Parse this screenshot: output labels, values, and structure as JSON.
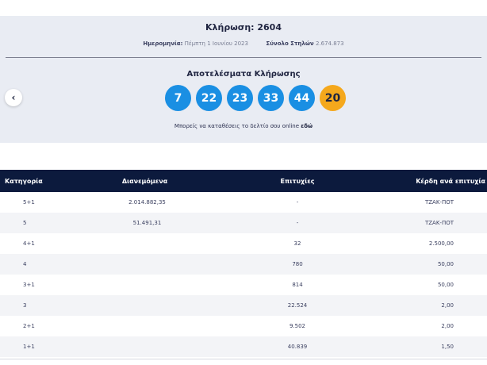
{
  "draw": {
    "title": "Κλήρωση: 2604",
    "date_label": "Ημερομηνία:",
    "date_value": "Πέμπτη 1 Ιουνίου 2023",
    "columns_label": "Σύνολο Στηλών",
    "columns_value": "2.674.873"
  },
  "results": {
    "title": "Αποτελέσματα Κλήρωσης",
    "numbers": [
      "7",
      "22",
      "23",
      "33",
      "44"
    ],
    "bonus": "20",
    "bet_text": "Μπορείς να καταθέσεις το δελτίο σου online",
    "bet_link": "εδώ",
    "prev_icon": "‹"
  },
  "colors": {
    "ball_main": "#1a8fe3",
    "ball_bonus": "#f5a81c",
    "header_bg": "#0c1a3d",
    "card_bg": "#e9ecf3"
  },
  "table": {
    "headers": [
      "Κατηγορία",
      "Διανεμόμενα",
      "Επιτυχίες",
      "Κέρδη ανά επιτυχία"
    ],
    "rows": [
      {
        "category": "5+1",
        "distributed": "2.014.882,35",
        "winners": "-",
        "prize": "ΤΖΑΚ-ΠΟΤ"
      },
      {
        "category": "5",
        "distributed": "51.491,31",
        "winners": "-",
        "prize": "ΤΖΑΚ-ΠΟΤ"
      },
      {
        "category": "4+1",
        "distributed": "",
        "winners": "32",
        "prize": "2.500,00"
      },
      {
        "category": "4",
        "distributed": "",
        "winners": "780",
        "prize": "50,00"
      },
      {
        "category": "3+1",
        "distributed": "",
        "winners": "814",
        "prize": "50,00"
      },
      {
        "category": "3",
        "distributed": "",
        "winners": "22.524",
        "prize": "2,00"
      },
      {
        "category": "2+1",
        "distributed": "",
        "winners": "9.502",
        "prize": "2,00"
      },
      {
        "category": "1+1",
        "distributed": "",
        "winners": "40.839",
        "prize": "1,50"
      }
    ]
  }
}
